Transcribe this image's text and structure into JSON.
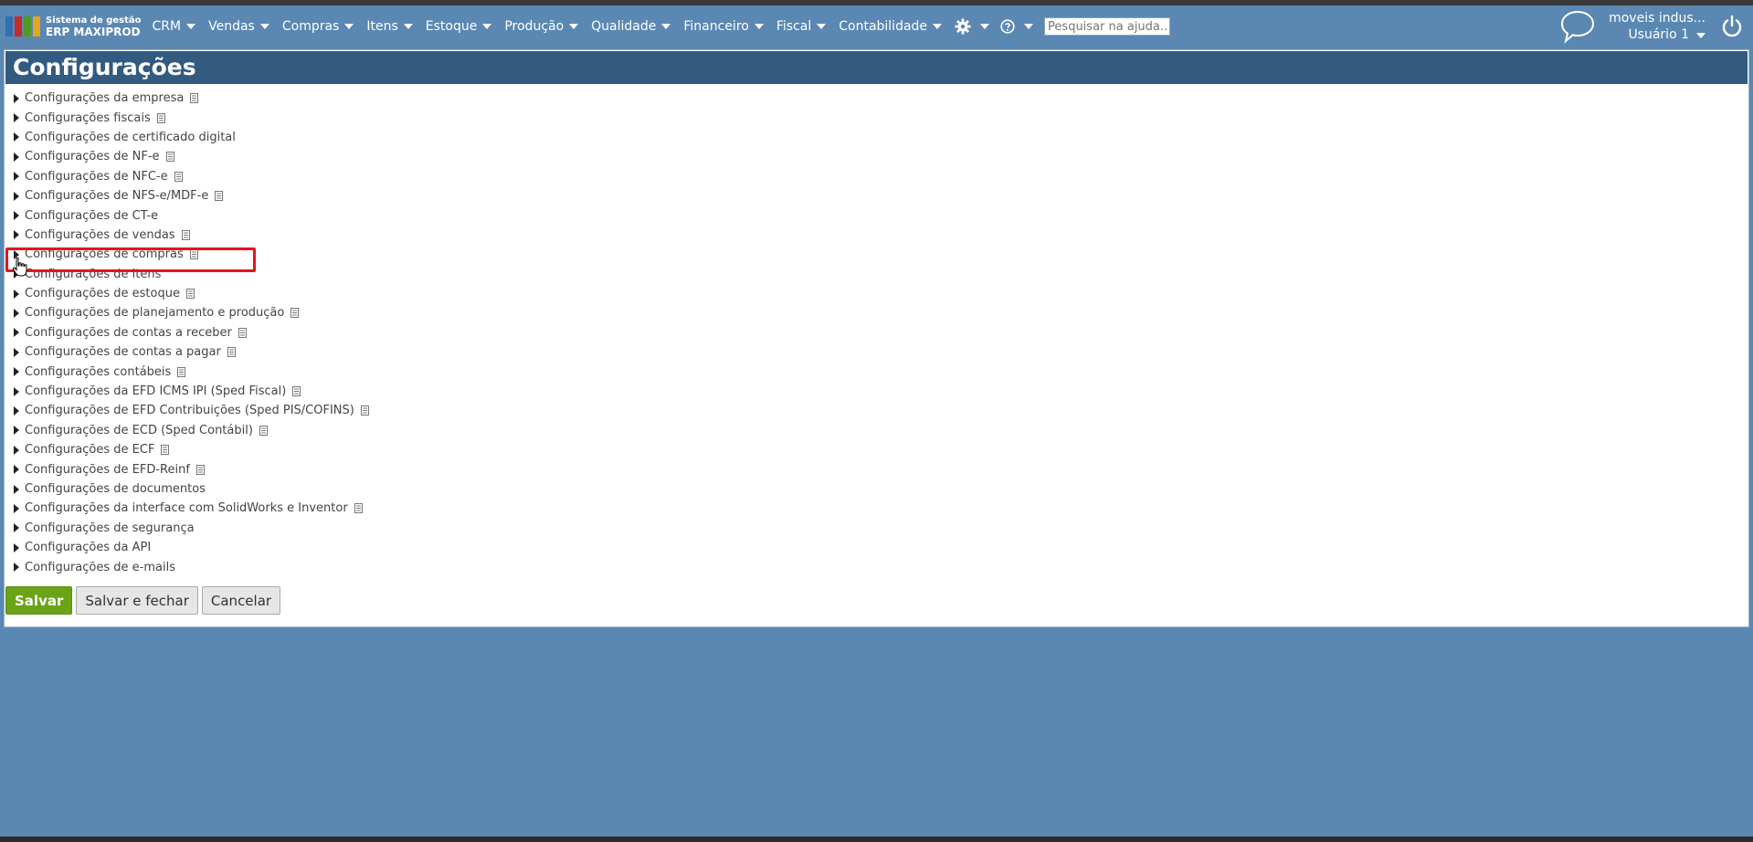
{
  "app": {
    "logo_line1": "Sistema de gestão",
    "logo_line2": "ERP MAXIPROD"
  },
  "menu": [
    {
      "label": "CRM"
    },
    {
      "label": "Vendas"
    },
    {
      "label": "Compras"
    },
    {
      "label": "Itens"
    },
    {
      "label": "Estoque"
    },
    {
      "label": "Produção"
    },
    {
      "label": "Qualidade"
    },
    {
      "label": "Financeiro"
    },
    {
      "label": "Fiscal"
    },
    {
      "label": "Contabilidade"
    }
  ],
  "search": {
    "placeholder": "Pesquisar na ajuda..."
  },
  "user": {
    "company": "moveis indus...",
    "name": "Usuário 1"
  },
  "page": {
    "title": "Configurações"
  },
  "settings": [
    {
      "label": "Configurações da empresa",
      "has_doc": true
    },
    {
      "label": "Configurações fiscais",
      "has_doc": true
    },
    {
      "label": "Configurações de certificado digital",
      "has_doc": false
    },
    {
      "label": "Configurações de NF-e",
      "has_doc": true
    },
    {
      "label": "Configurações de NFC-e",
      "has_doc": true
    },
    {
      "label": "Configurações de NFS-e/MDF-e",
      "has_doc": true
    },
    {
      "label": "Configurações de CT-e",
      "has_doc": false
    },
    {
      "label": "Configurações de vendas",
      "has_doc": true
    },
    {
      "label": "Configurações de compras",
      "has_doc": true
    },
    {
      "label": "Configurações de itens",
      "has_doc": false
    },
    {
      "label": "Configurações de estoque",
      "has_doc": true
    },
    {
      "label": "Configurações de planejamento e produção",
      "has_doc": true
    },
    {
      "label": "Configurações de contas a receber",
      "has_doc": true
    },
    {
      "label": "Configurações de contas a pagar",
      "has_doc": true
    },
    {
      "label": "Configurações contábeis",
      "has_doc": true
    },
    {
      "label": "Configurações da EFD ICMS IPI (Sped Fiscal)",
      "has_doc": true
    },
    {
      "label": "Configurações de EFD Contribuições (Sped PIS/COFINS)",
      "has_doc": true
    },
    {
      "label": "Configurações de ECD (Sped Contábil)",
      "has_doc": true
    },
    {
      "label": "Configurações de ECF",
      "has_doc": true
    },
    {
      "label": "Configurações de EFD-Reinf",
      "has_doc": true
    },
    {
      "label": "Configurações de documentos",
      "has_doc": false
    },
    {
      "label": "Configurações da interface com SolidWorks e Inventor",
      "has_doc": true
    },
    {
      "label": "Configurações de segurança",
      "has_doc": false
    },
    {
      "label": "Configurações da API",
      "has_doc": false
    },
    {
      "label": "Configurações de e-mails",
      "has_doc": false
    }
  ],
  "actions": {
    "save": "Salvar",
    "save_close": "Salvar e fechar",
    "cancel": "Cancelar"
  },
  "colors": {
    "background": "#5b88b3",
    "header": "#335a7f",
    "primary_button": "#6aa416",
    "highlight": "#e8131b"
  }
}
